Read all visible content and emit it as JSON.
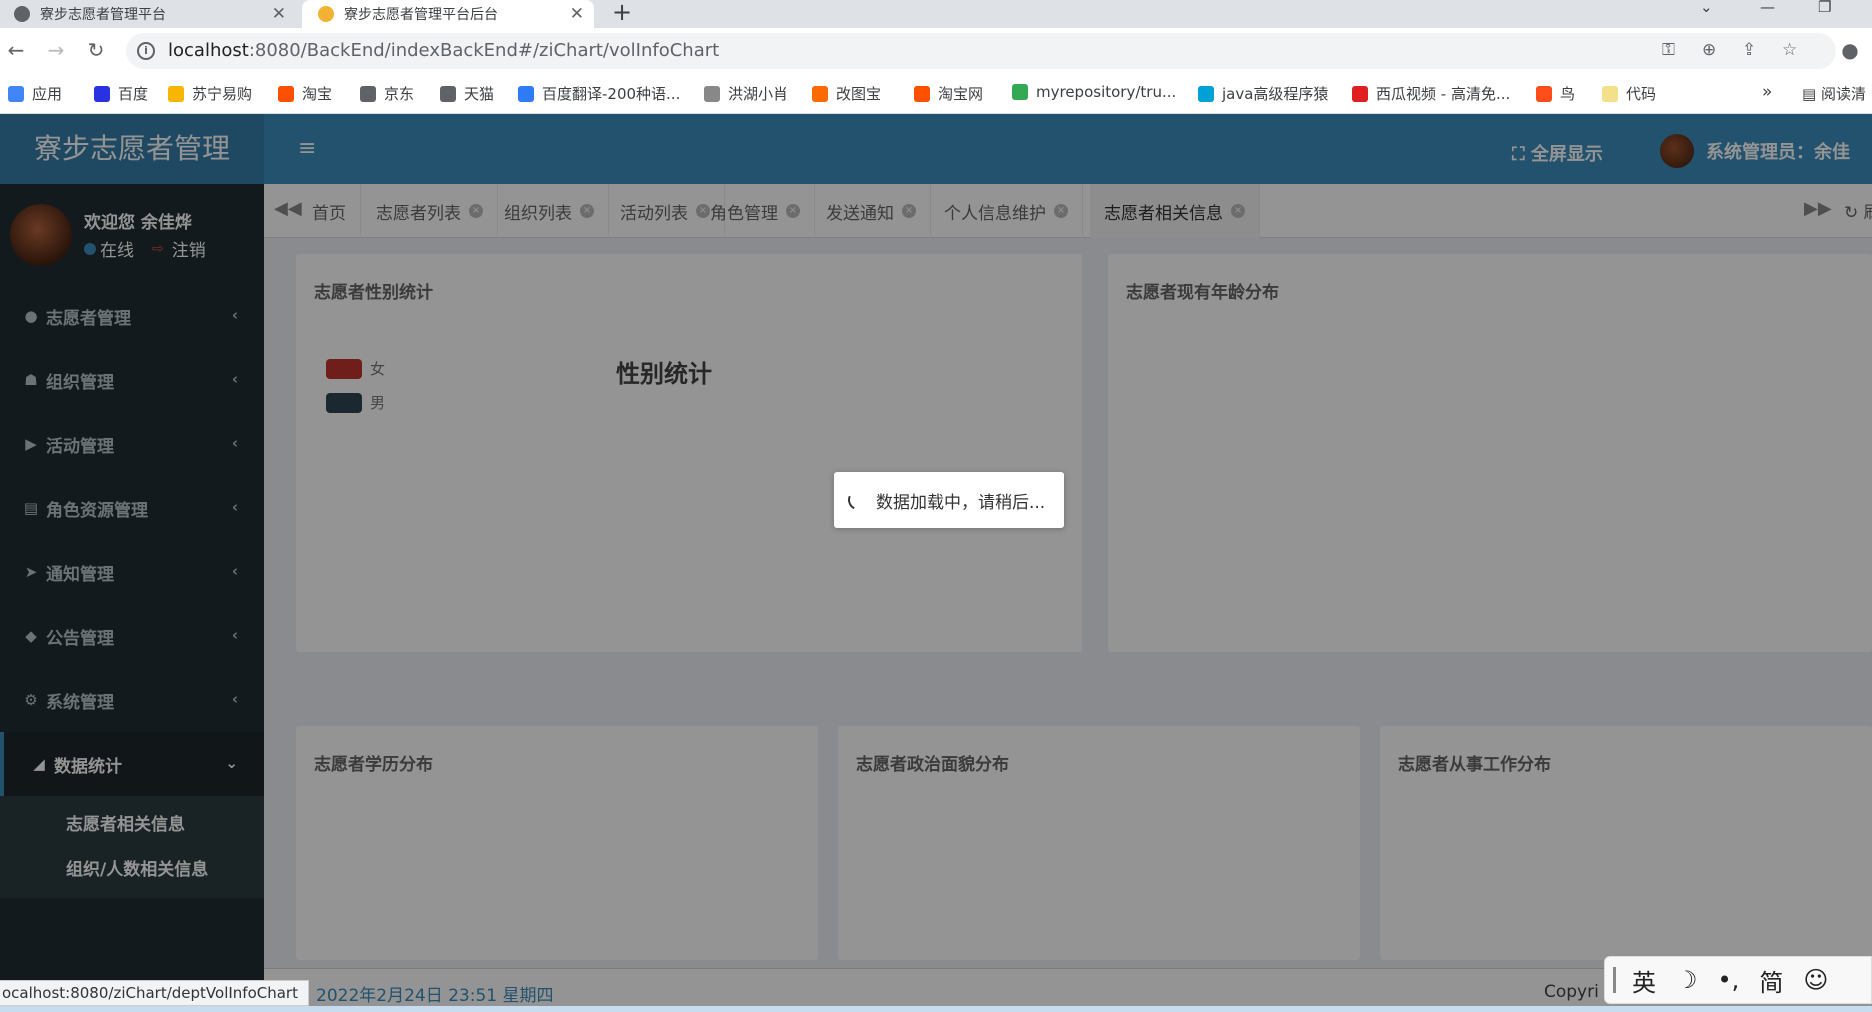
{
  "browser": {
    "tabs": [
      {
        "title": "寮步志愿者管理平台"
      },
      {
        "title": "寮步志愿者管理平台后台"
      }
    ],
    "close_glyph": "✕",
    "new_tab_glyph": "+",
    "url_host": "localhost",
    "url_rest": ":8080/BackEnd/indexBackEnd#/ziChart/volInfoChart",
    "bookmarks": [
      {
        "label": "应用",
        "color": "#4285f4"
      },
      {
        "label": "百度",
        "color": "#2932e1"
      },
      {
        "label": "苏宁易购",
        "color": "#f7b500"
      },
      {
        "label": "淘宝",
        "color": "#ff5000"
      },
      {
        "label": "京东",
        "color": "#5f6368"
      },
      {
        "label": "天猫",
        "color": "#5f6368"
      },
      {
        "label": "百度翻译-200种语...",
        "color": "#2f7bf5"
      },
      {
        "label": "洪湖小肖",
        "color": "#888888"
      },
      {
        "label": "改图宝",
        "color": "#ff6a00"
      },
      {
        "label": "淘宝网",
        "color": "#ff5000"
      },
      {
        "label": "myrepository/tru...",
        "color": "#34a853"
      },
      {
        "label": "java高级程序猿",
        "color": "#00a1d6"
      },
      {
        "label": "西瓜视频 - 高清免...",
        "color": "#e02020"
      },
      {
        "label": "鸟",
        "color": "#ff4d1a"
      },
      {
        "label": "代码",
        "color": "#f5e08a"
      }
    ],
    "bookmarks_more": "»",
    "reading_list": "阅读清"
  },
  "app": {
    "logo": "寮步志愿者管理",
    "fullscreen": "全屏显示",
    "admin_label": "系统管理员：余佳"
  },
  "sidebar": {
    "welcome": "欢迎您 余佳烨",
    "online": "在线",
    "logout": "注销",
    "menu": [
      {
        "label": "志愿者管理",
        "icon": "●"
      },
      {
        "label": "组织管理",
        "icon": "☗"
      },
      {
        "label": "活动管理",
        "icon": "▶"
      },
      {
        "label": "角色资源管理",
        "icon": "▤"
      },
      {
        "label": "通知管理",
        "icon": "➤"
      },
      {
        "label": "公告管理",
        "icon": "◆"
      },
      {
        "label": "系统管理",
        "icon": "⚙"
      }
    ],
    "open_menu": {
      "label": "数据统计",
      "icon": "◢"
    },
    "submenu": [
      "志愿者相关信息",
      "组织/人数相关信息"
    ]
  },
  "page_tabs": [
    {
      "label": "首页",
      "closable": false
    },
    {
      "label": "志愿者列表",
      "closable": true
    },
    {
      "label": "组织列表",
      "closable": true
    },
    {
      "label": "活动列表",
      "closable": true
    },
    {
      "label": "角色管理",
      "closable": true
    },
    {
      "label": "发送通知",
      "closable": true
    },
    {
      "label": "个人信息维护",
      "closable": true
    },
    {
      "label": "志愿者相关信息",
      "closable": true,
      "active": true
    }
  ],
  "refresh_label": "刷",
  "panels": {
    "gender": {
      "title": "志愿者性别统计",
      "chart_title": "性别统计",
      "legend": [
        {
          "label": "女",
          "color": "#c23531"
        },
        {
          "label": "男",
          "color": "#2f4554"
        }
      ]
    },
    "age": {
      "title": "志愿者现有年龄分布"
    },
    "education": {
      "title": "志愿者学历分布"
    },
    "politics": {
      "title": "志愿者政治面貌分布"
    },
    "occupation": {
      "title": "志愿者从事工作分布"
    }
  },
  "footer": {
    "date": "2022年2月24日 23:51 星期四",
    "copyright": "Copyri"
  },
  "loading": {
    "text": "数据加载中，请稍后..."
  },
  "status_bar_url": "ocalhost:8080/ziChart/deptVolInfoChart",
  "ime": {
    "lang": "英",
    "mode": "简"
  }
}
